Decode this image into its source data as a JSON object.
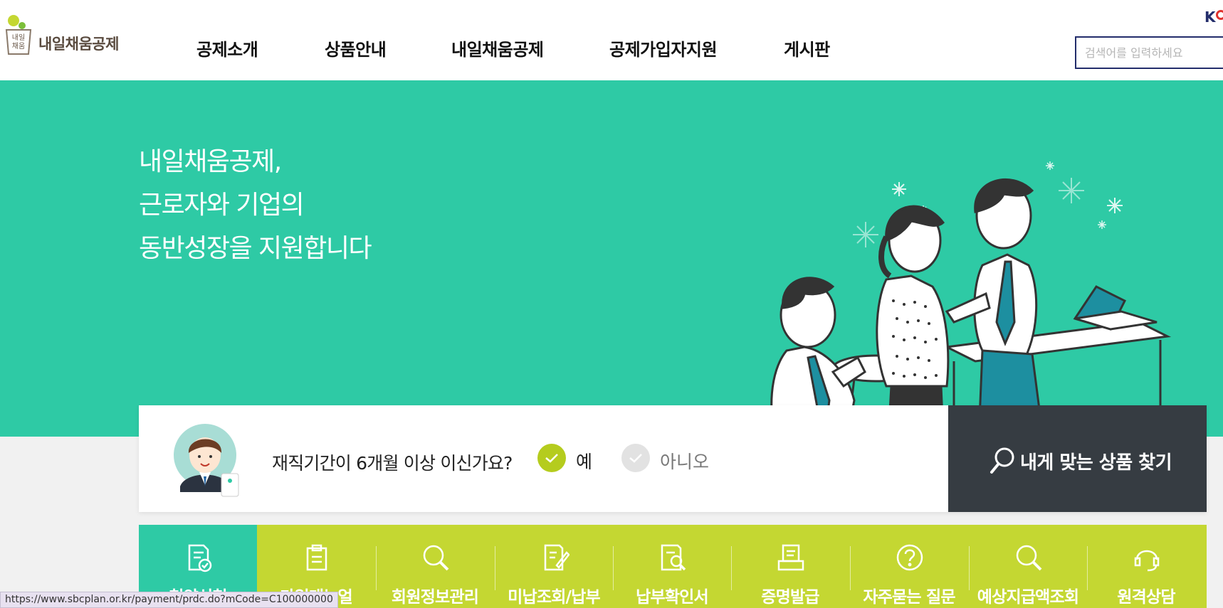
{
  "header": {
    "logo_text": "내일채움공제",
    "logo_mark_text_top": "내일",
    "logo_mark_text_bottom": "채움",
    "nav": [
      {
        "label": "공제소개"
      },
      {
        "label": "상품안내"
      },
      {
        "label": "내일채움공제"
      },
      {
        "label": "공제가입자지원"
      },
      {
        "label": "게시판"
      }
    ],
    "search_placeholder": "검색어를 입력하세요",
    "corner_logo_text": "K"
  },
  "hero": {
    "lines": [
      "내일채움공제,",
      "근로자와 기업의",
      "동반성장을 지원합니다"
    ]
  },
  "question_bar": {
    "question": "재직기간이 6개월 이상 이신가요?",
    "options": [
      {
        "label": "예",
        "selected": true
      },
      {
        "label": "아니오",
        "selected": false
      }
    ],
    "find_button": "내게 맞는 상품 찾기"
  },
  "quick_menu": [
    {
      "label": "청약신청",
      "icon": "document-check-icon",
      "active": true
    },
    {
      "label": "가입매뉴얼",
      "icon": "clipboard-icon",
      "active": false
    },
    {
      "label": "회원정보관리",
      "icon": "search-icon",
      "active": false
    },
    {
      "label": "미납조회/납부",
      "icon": "document-edit-icon",
      "active": false
    },
    {
      "label": "납부확인서",
      "icon": "document-search-icon",
      "active": false
    },
    {
      "label": "증명발급",
      "icon": "certificate-icon",
      "active": false
    },
    {
      "label": "자주묻는 질문",
      "icon": "question-icon",
      "active": false
    },
    {
      "label": "예상지급액조회",
      "icon": "search-icon",
      "active": false
    },
    {
      "label": "원격상담",
      "icon": "headset-icon",
      "active": false
    }
  ],
  "status_url": "https://www.sbcplan.or.kr/payment/prdc.do?mCode=C100000000",
  "colors": {
    "hero_bg": "#2ecaa5",
    "quick_menu_bg": "#c4d732",
    "find_button_bg": "#363c42",
    "check_selected": "#b5cc1e",
    "search_border": "#232d6b"
  }
}
